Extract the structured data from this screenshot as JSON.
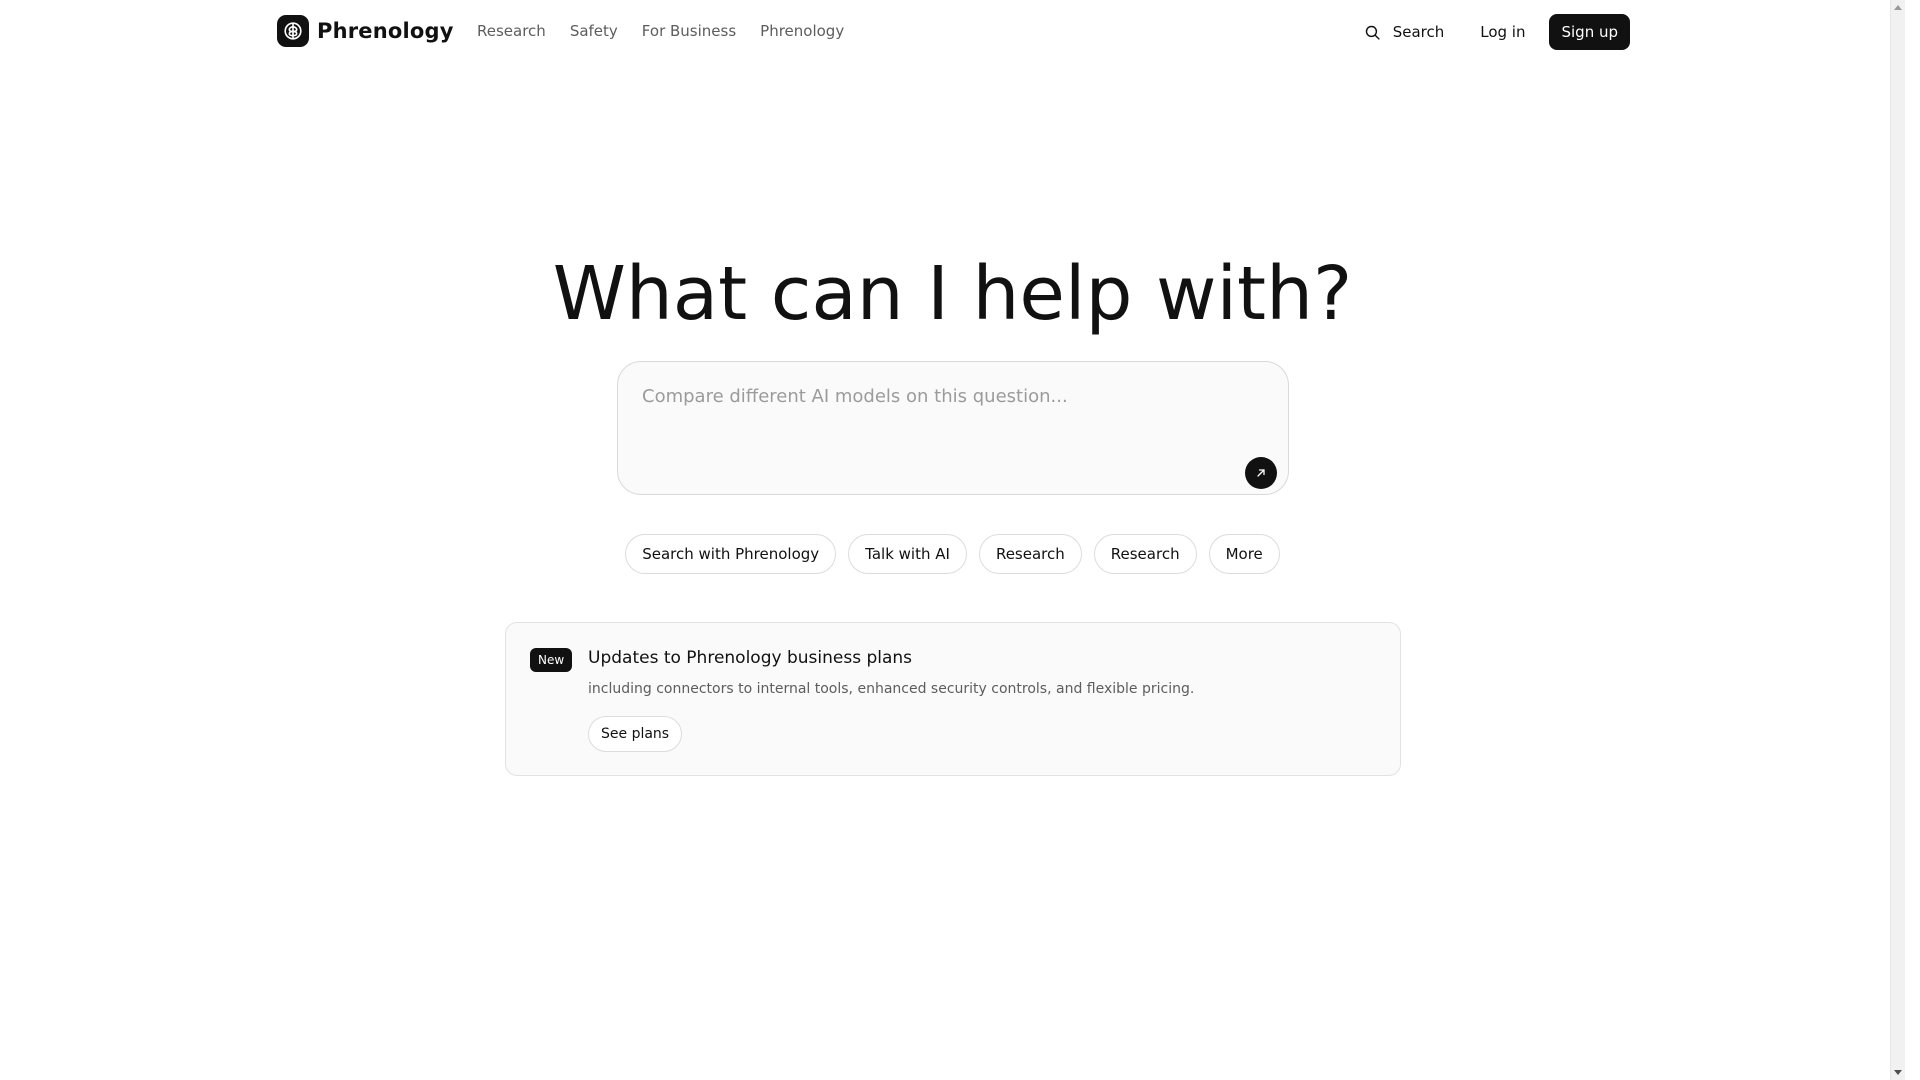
{
  "brand": {
    "name": "Phrenology",
    "logo_icon": "brain-icon"
  },
  "nav": {
    "links": [
      {
        "label": "Research"
      },
      {
        "label": "Safety"
      },
      {
        "label": "For Business"
      },
      {
        "label": "Phrenology"
      }
    ]
  },
  "header_actions": {
    "search_label": "Search",
    "search_icon": "search-icon",
    "login_label": "Log in",
    "signup_label": "Sign up"
  },
  "hero": {
    "title": "What can I help with?"
  },
  "composer": {
    "placeholder": "Compare different AI models on this question...",
    "value": "",
    "send_icon": "arrow-up-right-icon"
  },
  "chips": [
    {
      "label": "Search with Phrenology"
    },
    {
      "label": "Talk with AI"
    },
    {
      "label": "Research"
    },
    {
      "label": "Research"
    },
    {
      "label": "More"
    }
  ],
  "announcement": {
    "badge": "New",
    "title": "Updates to Phrenology business plans",
    "description": "including connectors to internal tools, enhanced security controls, and flexible pricing.",
    "button_label": "See plans"
  },
  "colors": {
    "text": "#111111",
    "muted_text": "#5d5d5d",
    "placeholder": "#9b9b9b",
    "accent_dark": "#111111",
    "border": "#dcdcdc",
    "card_background": "#fafafa"
  }
}
